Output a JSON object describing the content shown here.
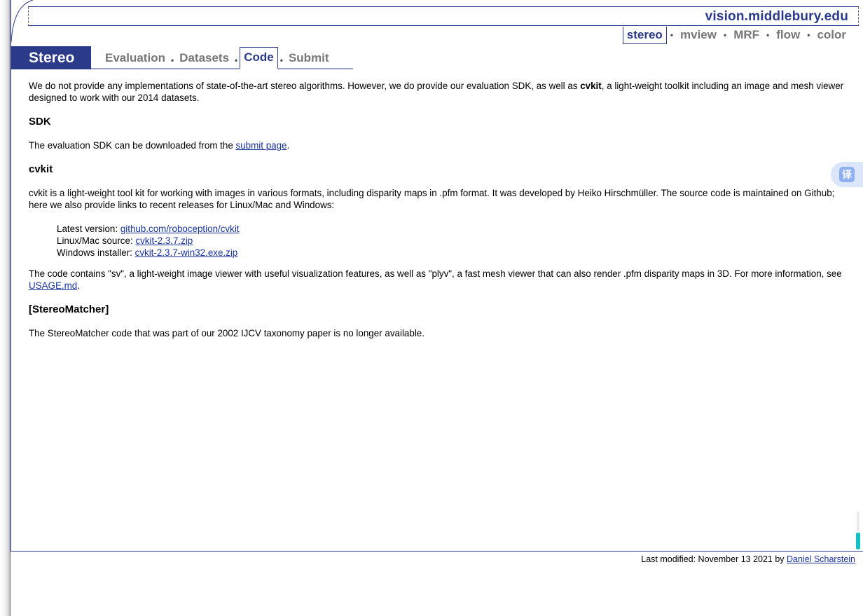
{
  "site": {
    "title": "vision.middlebury.edu",
    "nav": [
      {
        "label": "stereo",
        "active": true
      },
      {
        "label": "mview",
        "active": false
      },
      {
        "label": "MRF",
        "active": false
      },
      {
        "label": "flow",
        "active": false
      },
      {
        "label": "color",
        "active": false
      }
    ],
    "nav_separator": "•"
  },
  "section": {
    "title": "Stereo",
    "tabs": [
      {
        "label": "Evaluation",
        "active": false
      },
      {
        "label": "Datasets",
        "active": false
      },
      {
        "label": "Code",
        "active": true
      },
      {
        "label": "Submit",
        "active": false
      }
    ]
  },
  "content": {
    "intro_1": "We do not provide any implementations of state-of-the-art stereo algorithms. However, we do provide our evaluation SDK, as well as ",
    "intro_bold": "cvkit",
    "intro_2": ", a light-weight toolkit including an image and mesh viewer designed to work with our 2014 datasets.",
    "sdk_heading": "SDK",
    "sdk_text_1": "The evaluation SDK can be downloaded from the ",
    "sdk_link": "submit page",
    "sdk_text_2": ".",
    "cvkit_heading": "cvkit",
    "cvkit_text": "cvkit is a light-weight tool kit for working with images in various formats, including disparity maps in .pfm format. It was developed by Heiko Hirschmüller. The source code is maintained on Github; here we also provide links to recent releases for Linux/Mac and Windows:",
    "latest_label": "Latest version: ",
    "latest_link": "github.com/roboception/cvkit",
    "source_label": "Linux/Mac source: ",
    "source_link": "cvkit-2.3.7.zip",
    "windows_label": "Windows installer: ",
    "windows_link": "cvkit-2.3.7-win32.exe.zip",
    "code_text_1": "The code contains \"sv\", a light-weight image viewer with useful visualization features, as well as \"plyv\", a fast mesh viewer that can also render .pfm disparity maps in 3D. For more information, see ",
    "code_link": "USAGE.md",
    "code_text_2": ".",
    "matcher_heading": "[StereoMatcher]",
    "matcher_text": "The StereoMatcher code that was part of our 2002 IJCV taxonomy paper is no longer available."
  },
  "footer": {
    "text": "Last modified: November 13 2021 by ",
    "author_link": "Daniel Scharstein"
  },
  "translate_button": {
    "glyph": "译"
  },
  "colors": {
    "accent": "#2c3a8a",
    "link": "#1a34a0",
    "inactive_nav": "#777777"
  }
}
